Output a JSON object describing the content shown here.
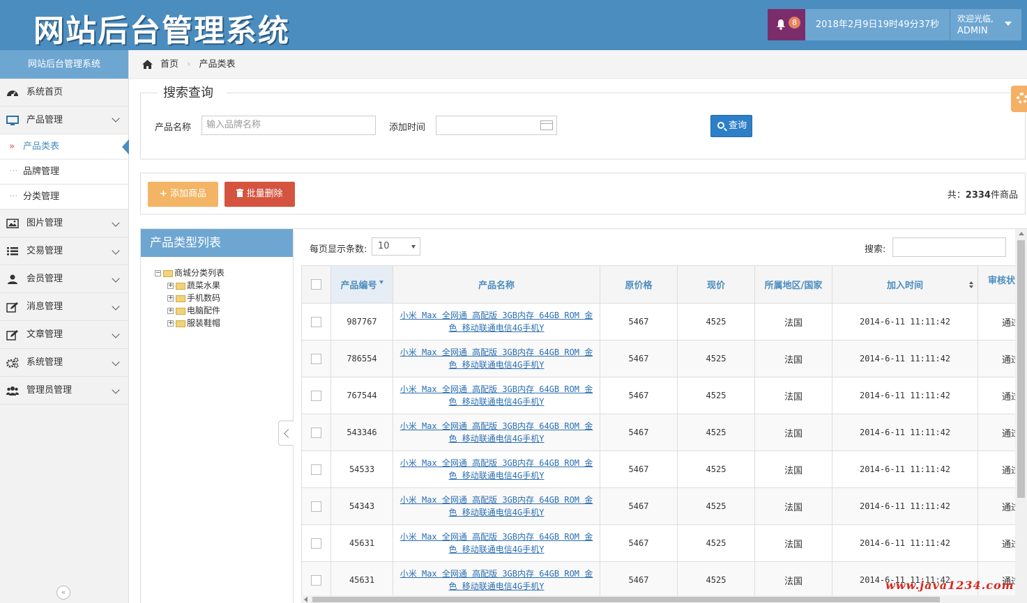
{
  "header": {
    "title": "网站后台管理系统",
    "notification_count": "8",
    "datetime": "2018年2月9日19时49分37秒",
    "welcome": "欢迎光临,",
    "username": "ADMIN"
  },
  "sidebar": {
    "title": "网站后台管理系统",
    "items": [
      {
        "label": "系统首页",
        "icon": "dashboard-icon"
      },
      {
        "label": "产品管理",
        "icon": "monitor-icon"
      },
      {
        "label": "图片管理",
        "icon": "picture-icon"
      },
      {
        "label": "交易管理",
        "icon": "list-icon"
      },
      {
        "label": "会员管理",
        "icon": "user-icon"
      },
      {
        "label": "消息管理",
        "icon": "edit-icon"
      },
      {
        "label": "文章管理",
        "icon": "edit-icon"
      },
      {
        "label": "系统管理",
        "icon": "gears-icon"
      },
      {
        "label": "管理员管理",
        "icon": "group-icon"
      }
    ],
    "sub_items": [
      "产品类表",
      "品牌管理",
      "分类管理"
    ],
    "collapse_glyph": "«"
  },
  "breadcrumb": {
    "home": "首页",
    "current": "产品类表"
  },
  "search": {
    "legend": "搜索查询",
    "name_label": "产品名称",
    "name_placeholder": "输入品牌名称",
    "time_label": "添加时间",
    "query_button": "查询"
  },
  "actions": {
    "add_label": "添加商品",
    "delete_label": "批量删除",
    "total_prefix": "共：",
    "total_count": "2334",
    "total_suffix": "件商品"
  },
  "tree": {
    "title": "产品类型列表",
    "root": "商城分类列表",
    "children": [
      "蔬菜水果",
      "手机数码",
      "电脑配件",
      "服装鞋帽"
    ]
  },
  "table": {
    "page_size_label": "每页显示条数:",
    "page_size_value": "10",
    "search_label": "搜索:",
    "columns": [
      "产品编号",
      "产品名称",
      "原价格",
      "现价",
      "所属地区/国家",
      "加入时间",
      "审核状"
    ],
    "rows": [
      {
        "id": "987767",
        "name": "小米 Max 全网通 高配版 3GB内存 64GB ROM 金色 移动联通电信4G手机Y",
        "orig": "5467",
        "price": "4525",
        "region": "法国",
        "time": "2014-6-11 11:11:42",
        "status": "通过"
      },
      {
        "id": "786554",
        "name": "小米 Max 全网通 高配版 3GB内存 64GB ROM 金色 移动联通电信4G手机Y",
        "orig": "5467",
        "price": "4525",
        "region": "法国",
        "time": "2014-6-11 11:11:42",
        "status": "通过"
      },
      {
        "id": "767544",
        "name": "小米 Max 全网通 高配版 3GB内存 64GB ROM 金色 移动联通电信4G手机Y",
        "orig": "5467",
        "price": "4525",
        "region": "法国",
        "time": "2014-6-11 11:11:42",
        "status": "通过"
      },
      {
        "id": "543346",
        "name": "小米 Max 全网通 高配版 3GB内存 64GB ROM 金色 移动联通电信4G手机Y",
        "orig": "5467",
        "price": "4525",
        "region": "法国",
        "time": "2014-6-11 11:11:42",
        "status": "通过"
      },
      {
        "id": "54533",
        "name": "小米 Max 全网通 高配版 3GB内存 64GB ROM 金色 移动联通电信4G手机Y",
        "orig": "5467",
        "price": "4525",
        "region": "法国",
        "time": "2014-6-11 11:11:42",
        "status": "通过"
      },
      {
        "id": "54343",
        "name": "小米 Max 全网通 高配版 3GB内存 64GB ROM 金色 移动联通电信4G手机Y",
        "orig": "5467",
        "price": "4525",
        "region": "法国",
        "time": "2014-6-11 11:11:42",
        "status": "通过"
      },
      {
        "id": "45631",
        "name": "小米 Max 全网通 高配版 3GB内存 64GB ROM 金色 移动联通电信4G手机Y",
        "orig": "5467",
        "price": "4525",
        "region": "法国",
        "time": "2014-6-11 11:11:42",
        "status": "通过"
      },
      {
        "id": "45631",
        "name": "小米 Max 全网通 高配版 3GB内存 64GB ROM 金色 移动联通电信4G手机Y",
        "orig": "5467",
        "price": "4525",
        "region": "法国",
        "time": "2014-6-11 11:11:42",
        "status": "通过"
      }
    ]
  },
  "watermark": "www.java1234.com",
  "colors": {
    "header": "#4b8dbf",
    "accent": "#6ea6d2",
    "add": "#f3b565",
    "delete": "#d5543f",
    "query": "#2d7fc8"
  }
}
